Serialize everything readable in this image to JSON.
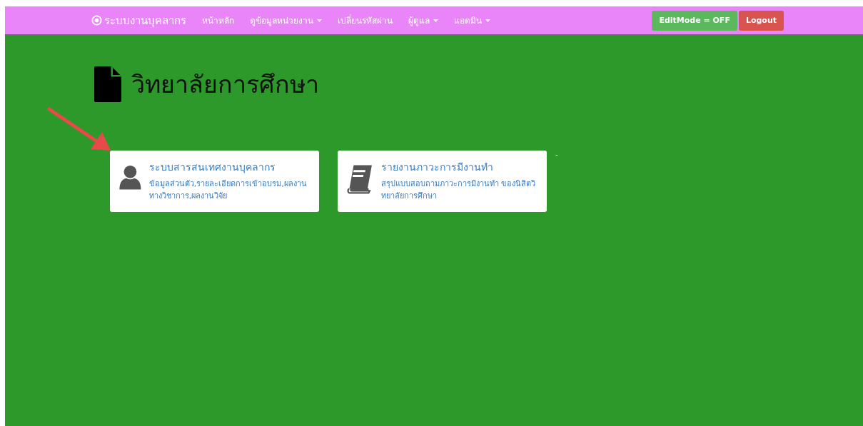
{
  "navbar": {
    "brand": "ระบบงานบุคลากร",
    "items": [
      {
        "label": "หน้าหลัก",
        "dropdown": false
      },
      {
        "label": "ดูข้อมูลหน่วยงาน",
        "dropdown": true
      },
      {
        "label": "เปลี่ยนรหัสผ่าน",
        "dropdown": false
      },
      {
        "label": "ผู้ดูแล",
        "dropdown": true
      },
      {
        "label": "แอดมิน",
        "dropdown": true
      }
    ],
    "buttons": [
      {
        "label": "EditMode = OFF",
        "kind": "success"
      },
      {
        "label": "Logout",
        "kind": "danger"
      }
    ]
  },
  "page_title": "วิทยาลัยการศึกษา",
  "cards": [
    {
      "kind": "person",
      "title": "ระบบสารสนเทศงานบุคลากร",
      "description": "ข้อมูลส่วนตัว,รายละเอียดการเข้าอบรม,ผลงานทางวิชาการ,ผลงานวิจัย"
    },
    {
      "kind": "book",
      "title": "รายงานภาวะการมีงานทำ",
      "description": "สรุปแบบสอบถามภาวะการมีงานทำ ของนิสิตวิทยาลัยการศึกษา"
    }
  ],
  "trailing_mark": "-"
}
